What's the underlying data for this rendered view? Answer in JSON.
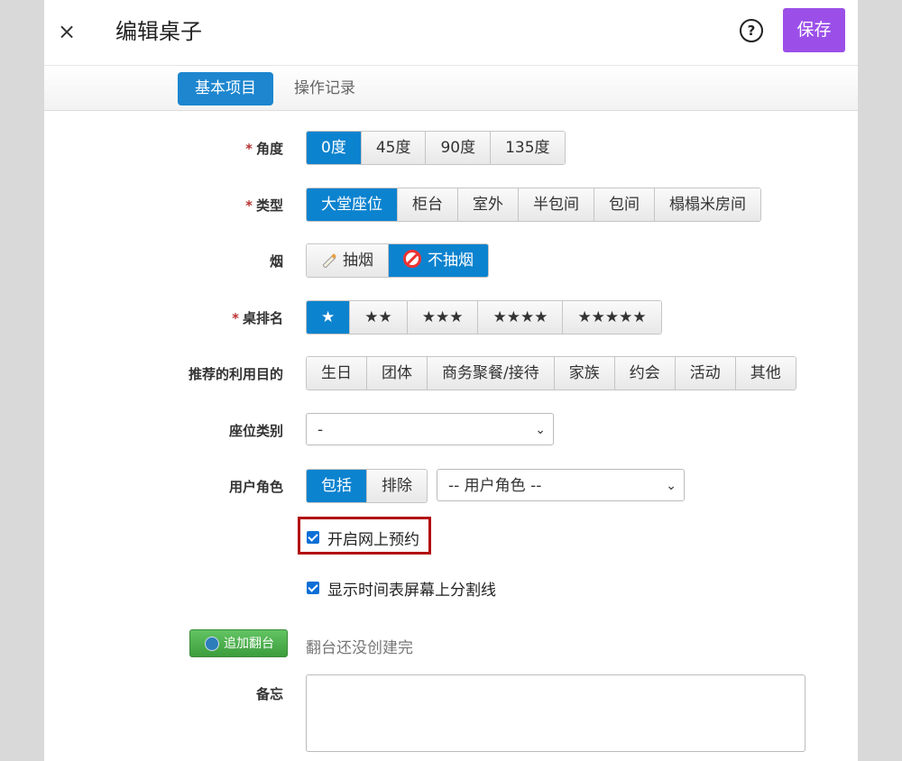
{
  "header": {
    "close_label": "×",
    "title": "编辑桌子",
    "help_label": "?",
    "save_label": "保存"
  },
  "tabs": [
    {
      "label": "基本项目",
      "active": true
    },
    {
      "label": "操作记录",
      "active": false
    }
  ],
  "form": {
    "angle": {
      "label": "角度",
      "required": "*",
      "options": [
        "0度",
        "45度",
        "90度",
        "135度"
      ],
      "selected": "0度"
    },
    "type": {
      "label": "类型",
      "required": "*",
      "options": [
        "大堂座位",
        "柜台",
        "室外",
        "半包间",
        "包间",
        "榻榻米房间"
      ],
      "selected": "大堂座位"
    },
    "smoking": {
      "label": "烟",
      "options": [
        "抽烟",
        "不抽烟"
      ],
      "selected": "不抽烟"
    },
    "rank": {
      "label": "桌排名",
      "required": "*",
      "options": [
        "★",
        "★★",
        "★★★",
        "★★★★",
        "★★★★★"
      ],
      "selected": "★"
    },
    "purpose": {
      "label": "推荐的利用目的",
      "options": [
        "生日",
        "团体",
        "商务聚餐/接待",
        "家族",
        "约会",
        "活动",
        "其他"
      ]
    },
    "seat_category": {
      "label": "座位类别",
      "value": "-"
    },
    "user_role": {
      "label": "用户角色",
      "options": [
        "包括",
        "排除"
      ],
      "selected": "包括",
      "select_value": "-- 用户角色 --"
    },
    "online_booking": {
      "label": "开启网上预约",
      "checked": true
    },
    "show_divider": {
      "label": "显示时间表屏幕上分割线",
      "checked": true
    },
    "turnover": {
      "button_label": "追加翻台",
      "note": "翻台还没创建完"
    },
    "memo": {
      "label": "备忘",
      "value": ""
    }
  },
  "colors": {
    "accent": "#0c83cf",
    "save": "#9b4fe8",
    "highlight": "#b30d0d",
    "add_button": "#4cae4c"
  }
}
